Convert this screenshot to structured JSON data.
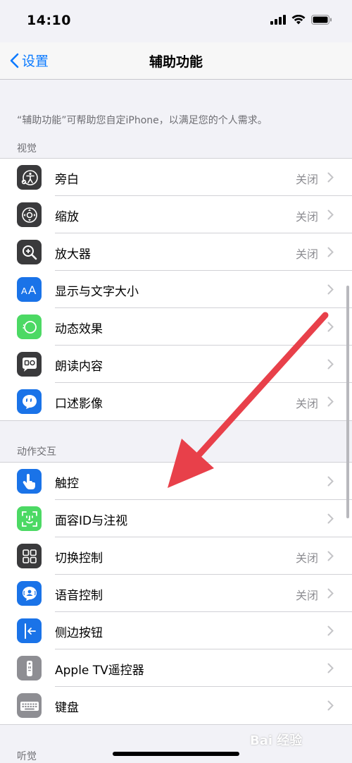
{
  "status": {
    "time": "14:10"
  },
  "nav": {
    "back_label": "设置",
    "title": "辅助功能"
  },
  "intro": "“辅助功能”可帮助您自定iPhone，以满足您的个人需求。",
  "sections": {
    "vision": {
      "header": "视觉",
      "items": [
        {
          "label": "旁白",
          "value": "关闭",
          "icon": "voiceover-icon"
        },
        {
          "label": "缩放",
          "value": "关闭",
          "icon": "zoom-icon"
        },
        {
          "label": "放大器",
          "value": "关闭",
          "icon": "magnifier-icon"
        },
        {
          "label": "显示与文字大小",
          "value": "",
          "icon": "text-size-icon"
        },
        {
          "label": "动态效果",
          "value": "",
          "icon": "motion-icon"
        },
        {
          "label": "朗读内容",
          "value": "",
          "icon": "spoken-content-icon"
        },
        {
          "label": "口述影像",
          "value": "关闭",
          "icon": "audio-description-icon"
        }
      ]
    },
    "physical": {
      "header": "动作交互",
      "items": [
        {
          "label": "触控",
          "value": "",
          "icon": "touch-icon"
        },
        {
          "label": "面容ID与注视",
          "value": "",
          "icon": "face-id-icon"
        },
        {
          "label": "切换控制",
          "value": "关闭",
          "icon": "switch-control-icon"
        },
        {
          "label": "语音控制",
          "value": "关闭",
          "icon": "voice-control-icon"
        },
        {
          "label": "侧边按钮",
          "value": "",
          "icon": "side-button-icon"
        },
        {
          "label": "Apple TV遥控器",
          "value": "",
          "icon": "apple-tv-remote-icon"
        },
        {
          "label": "键盘",
          "value": "",
          "icon": "keyboard-icon"
        }
      ]
    },
    "hearing": {
      "header": "听觉"
    }
  },
  "watermark": "Bai 经验",
  "colors": {
    "accent": "#0a7aff",
    "arrow": "#e8404a",
    "icon_dark": "#3a3a3c",
    "icon_blue": "#1a73e8",
    "icon_green": "#4cd964",
    "icon_gray": "#8e8e93"
  }
}
